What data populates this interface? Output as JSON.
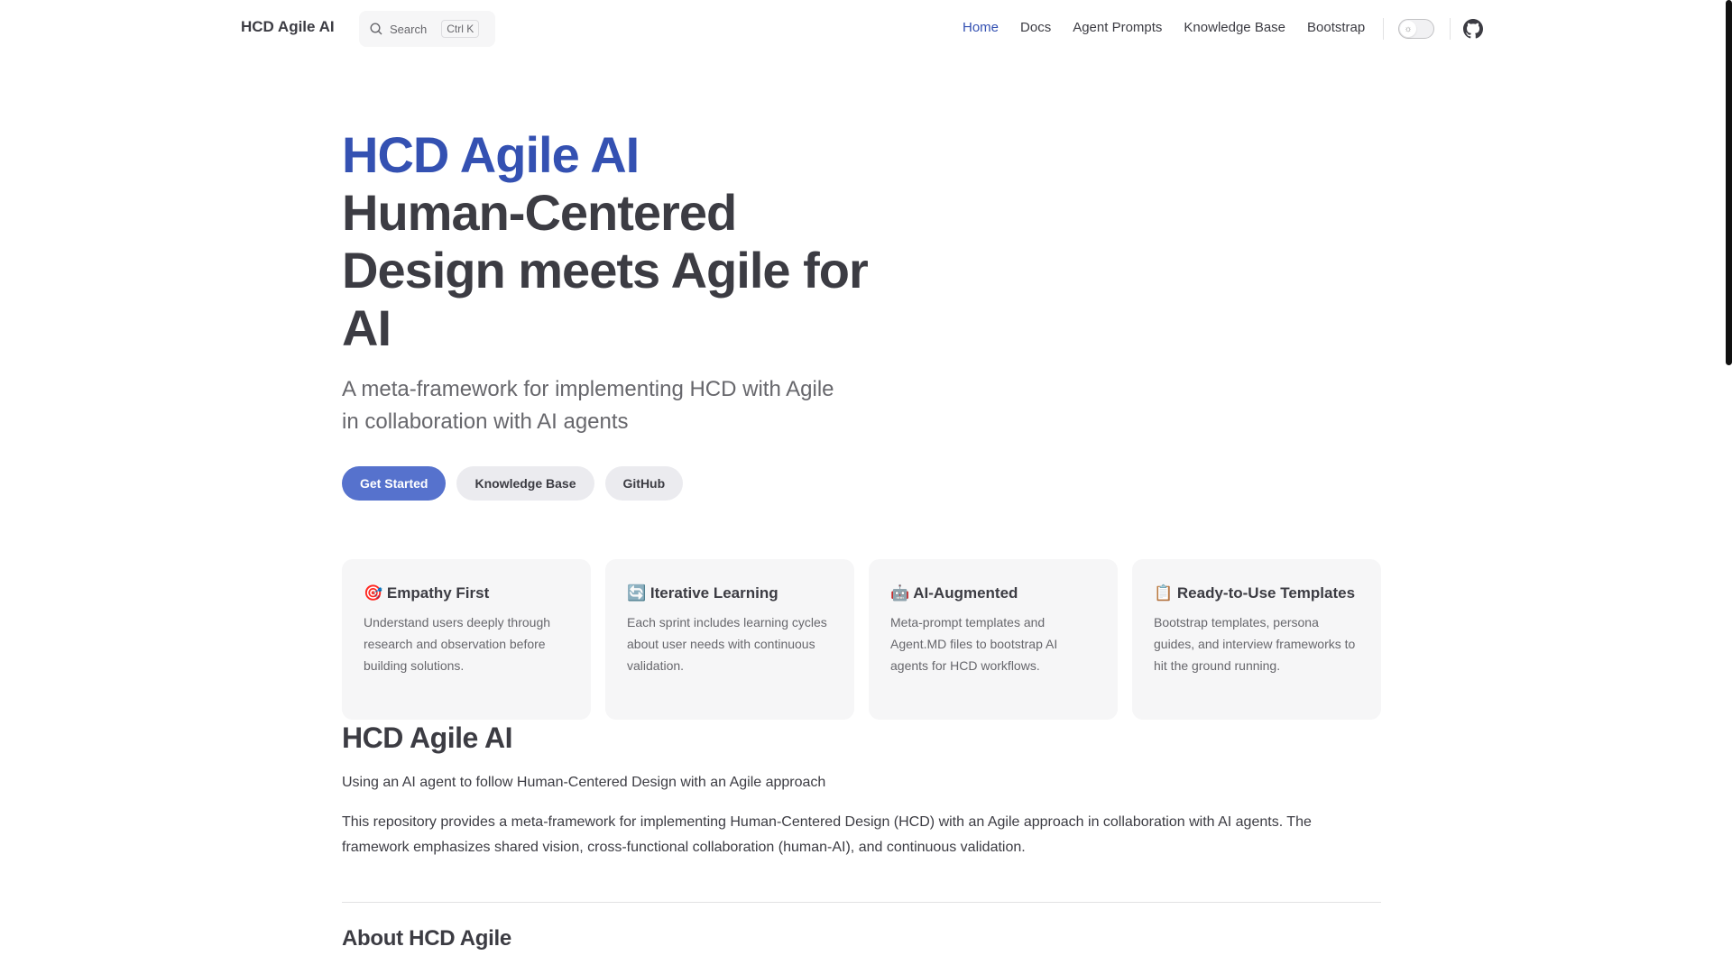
{
  "nav": {
    "logo": "HCD Agile AI",
    "search_label": "Search",
    "search_kbd": "Ctrl K",
    "links": [
      {
        "label": "Home",
        "active": true
      },
      {
        "label": "Docs"
      },
      {
        "label": "Agent Prompts"
      },
      {
        "label": "Knowledge Base"
      },
      {
        "label": "Bootstrap"
      }
    ],
    "theme_icon": "sun-icon",
    "github_icon": "github-icon"
  },
  "hero": {
    "name": "HCD Agile AI",
    "text": "Human-Centered Design meets Agile for AI",
    "tagline": "A meta-framework for implementing HCD with Agile in collaboration with AI agents",
    "actions": [
      "Get Started",
      "Knowledge Base",
      "GitHub"
    ]
  },
  "features": [
    {
      "icon": "🎯",
      "title": "Empathy First",
      "details": "Understand users deeply through research and observation before building solutions."
    },
    {
      "icon": "🔄",
      "title": "Iterative Learning",
      "details": "Each sprint includes learning cycles about user needs with continuous validation."
    },
    {
      "icon": "🤖",
      "title": "AI-Augmented",
      "details": "Meta-prompt templates and Agent.MD files to bootstrap AI agents for HCD workflows."
    },
    {
      "icon": "📋",
      "title": "Ready-to-Use Templates",
      "details": "Bootstrap templates, persona guides, and interview frameworks to hit the ground running."
    }
  ],
  "content": {
    "h1": "HCD Agile AI",
    "p1": "Using an AI agent to follow Human-Centered Design with an Agile approach",
    "p2": "This repository provides a meta-framework for implementing Human-Centered Design (HCD) with an Agile approach in collaboration with AI agents. The framework emphasizes shared vision, cross-functional collaboration (human-AI), and continuous validation.",
    "h2": "About HCD Agile"
  },
  "colors": {
    "brand": "#3451b2",
    "button": "#5672cd",
    "text": "#3c3c43"
  }
}
